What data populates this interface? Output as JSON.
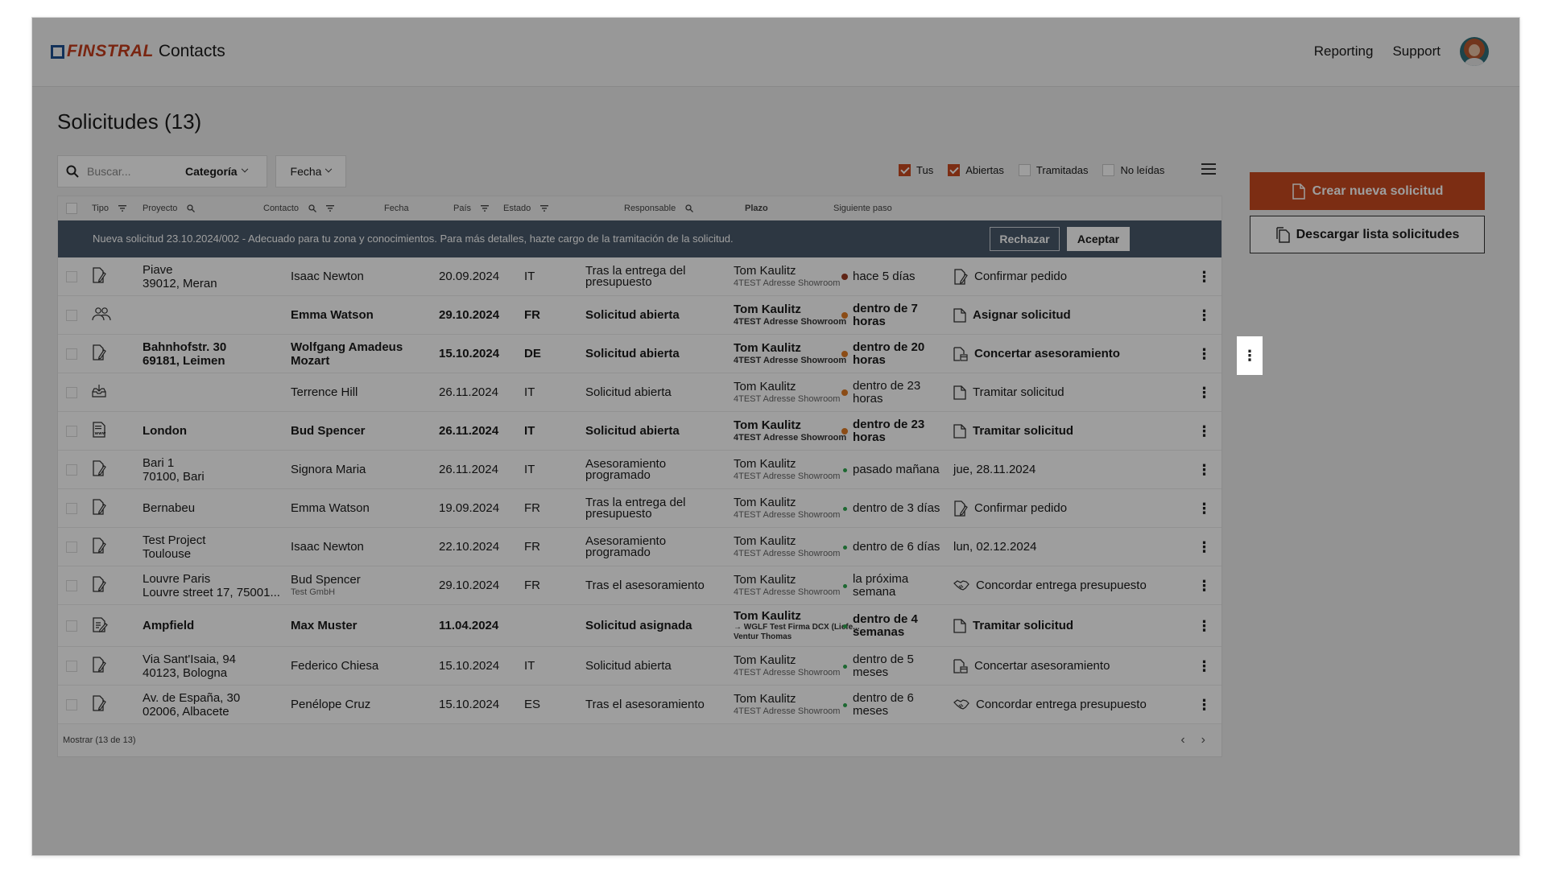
{
  "header": {
    "brand": "FINSTRAL",
    "product": "Contacts",
    "nav": [
      "Reporting",
      "Support"
    ]
  },
  "page": {
    "title": "Solicitudes (13)"
  },
  "filters": {
    "search_placeholder": "Buscar...",
    "category_label": "Categoría",
    "date_label": "Fecha",
    "checkboxes": [
      {
        "label": "Tus",
        "checked": true
      },
      {
        "label": "Abiertas",
        "checked": true
      },
      {
        "label": "Tramitadas",
        "checked": false
      },
      {
        "label": "No leídas",
        "checked": false
      }
    ]
  },
  "actions": {
    "create": "Crear nueva solicitud",
    "download": "Descargar lista solicitudes"
  },
  "table": {
    "columns": [
      "Tipo",
      "Proyecto",
      "Contacto",
      "Fecha",
      "País",
      "Estado",
      "Responsable",
      "Plazo",
      "Siguiente paso"
    ],
    "banner": {
      "message": "Nueva solicitud 23.10.2024/002 - Adecuado para tu zona y conocimientos. Para más detalles, hazte cargo de la tramitación de la solicitud.",
      "reject": "Rechazar",
      "accept": "Aceptar"
    },
    "rows": [
      {
        "type_icon": "document-pen-icon",
        "project": [
          "Piave",
          "39012, Meran"
        ],
        "contact": "Isaac Newton",
        "contact_sub": "",
        "date": "20.09.2024",
        "country": "IT",
        "status": "Tras la entrega del presupuesto",
        "resp": "Tom Kaulitz",
        "resp_sub": "4TEST Adresse Showroom",
        "dot": "brown",
        "plazo": "hace 5 días",
        "next_icon": "document-pen-icon",
        "next": "Confirmar pedido",
        "bold": false
      },
      {
        "type_icon": "people-icon",
        "project": [
          "",
          ""
        ],
        "contact": "Emma Watson",
        "contact_sub": "",
        "date": "29.10.2024",
        "country": "FR",
        "status": "Solicitud abierta",
        "resp": "Tom Kaulitz",
        "resp_sub": "4TEST Adresse Showroom",
        "dot": "orange",
        "plazo": "dentro de 7 horas",
        "next_icon": "document-icon",
        "next": "Asignar solicitud",
        "bold": true
      },
      {
        "type_icon": "document-pen-icon",
        "project": [
          "Bahnhofstr. 30",
          "69181, Leimen"
        ],
        "contact": "Wolfgang Amadeus Mozart",
        "contact_sub": "",
        "date": "15.10.2024",
        "country": "DE",
        "status": "Solicitud abierta",
        "resp": "Tom Kaulitz",
        "resp_sub": "4TEST Adresse Showroom",
        "dot": "orange",
        "plazo": "dentro de 20 horas",
        "next_icon": "document-calendar-icon",
        "next": "Concertar asesoramiento",
        "bold": true
      },
      {
        "type_icon": "inbox-icon",
        "project": [
          "",
          ""
        ],
        "contact": "Terrence Hill",
        "contact_sub": "",
        "date": "26.11.2024",
        "country": "IT",
        "status": "Solicitud abierta",
        "resp": "Tom Kaulitz",
        "resp_sub": "4TEST Adresse Showroom",
        "dot": "orange",
        "plazo": "dentro de 23 horas",
        "next_icon": "document-icon",
        "next": "Tramitar solicitud",
        "bold": false
      },
      {
        "type_icon": "document-www-icon",
        "project": [
          "London",
          ""
        ],
        "contact": "Bud Spencer",
        "contact_sub": "",
        "date": "26.11.2024",
        "country": "IT",
        "status": "Solicitud abierta",
        "resp": "Tom Kaulitz",
        "resp_sub": "4TEST Adresse Showroom",
        "dot": "orange",
        "plazo": "dentro de 23 horas",
        "next_icon": "document-icon",
        "next": "Tramitar solicitud",
        "bold": true
      },
      {
        "type_icon": "document-pen-icon",
        "project": [
          "Bari 1",
          "70100, Bari"
        ],
        "contact": "Signora Maria",
        "contact_sub": "",
        "date": "26.11.2024",
        "country": "IT",
        "status": "Asesoramiento programado",
        "resp": "Tom Kaulitz",
        "resp_sub": "4TEST Adresse Showroom",
        "dot": "green",
        "plazo": "pasado mañana",
        "next_icon": "",
        "next": "jue, 28.11.2024",
        "bold": false
      },
      {
        "type_icon": "document-pen-icon",
        "project": [
          "Bernabeu",
          ""
        ],
        "contact": "Emma Watson",
        "contact_sub": "",
        "date": "19.09.2024",
        "country": "FR",
        "status": "Tras la entrega del presupuesto",
        "resp": "Tom Kaulitz",
        "resp_sub": "4TEST Adresse Showroom",
        "dot": "green",
        "plazo": "dentro de 3 días",
        "next_icon": "document-pen-icon",
        "next": "Confirmar pedido",
        "bold": false
      },
      {
        "type_icon": "document-pen-icon",
        "project": [
          "Test Project",
          "Toulouse"
        ],
        "contact": "Isaac Newton",
        "contact_sub": "",
        "date": "22.10.2024",
        "country": "FR",
        "status": "Asesoramiento programado",
        "resp": "Tom Kaulitz",
        "resp_sub": "4TEST Adresse Showroom",
        "dot": "green",
        "plazo": "dentro de 6 días",
        "next_icon": "",
        "next": "lun, 02.12.2024",
        "bold": false
      },
      {
        "type_icon": "document-pen-icon",
        "project": [
          "Louvre Paris",
          "Louvre street 17, 75001..."
        ],
        "contact": "Bud Spencer",
        "contact_sub": "Test GmbH",
        "date": "29.10.2024",
        "country": "FR",
        "status": "Tras el asesoramiento",
        "resp": "Tom Kaulitz",
        "resp_sub": "4TEST Adresse Showroom",
        "dot": "green",
        "plazo": "la próxima semana",
        "next_icon": "handshake-icon",
        "next": "Concordar entrega presupuesto",
        "bold": false
      },
      {
        "type_icon": "document-edit-icon",
        "project": [
          "Ampfield",
          ""
        ],
        "contact": "Max Muster",
        "contact_sub": "",
        "date": "11.04.2024",
        "country": "",
        "status": "Solicitud asignada",
        "resp": "Tom Kaulitz",
        "resp_sub": "→ WGLF Test Firma DCX (Liefe... Ventur Thomas",
        "dot": "green",
        "plazo": "dentro de 4 semanas",
        "next_icon": "document-icon",
        "next": "Tramitar solicitud",
        "bold": true,
        "tall": true
      },
      {
        "type_icon": "document-pen-icon",
        "project": [
          "Via Sant'Isaia, 94",
          "40123, Bologna"
        ],
        "contact": "Federico Chiesa",
        "contact_sub": "",
        "date": "15.10.2024",
        "country": "IT",
        "status": "Solicitud abierta",
        "resp": "Tom Kaulitz",
        "resp_sub": "4TEST Adresse Showroom",
        "dot": "green",
        "plazo": "dentro de 5 meses",
        "next_icon": "document-calendar-icon",
        "next": "Concertar asesoramiento",
        "bold": false
      },
      {
        "type_icon": "document-pen-icon",
        "project": [
          "Av. de España, 30",
          "02006, Albacete"
        ],
        "contact": "Penélope Cruz",
        "contact_sub": "",
        "date": "15.10.2024",
        "country": "ES",
        "status": "Tras el asesoramiento",
        "resp": "Tom Kaulitz",
        "resp_sub": "4TEST Adresse Showroom",
        "dot": "green",
        "plazo": "dentro de 6 meses",
        "next_icon": "handshake-icon",
        "next": "Concordar entrega presupuesto",
        "bold": false
      }
    ],
    "footer": {
      "show_label": "Mostrar",
      "count": "(13 de 13)"
    }
  },
  "colors": {
    "accent": "#c9491f",
    "banner": "#4a5a6b",
    "dot_orange": "#e07b24",
    "dot_green": "#2fa84f",
    "dot_brown": "#9a3a22"
  }
}
